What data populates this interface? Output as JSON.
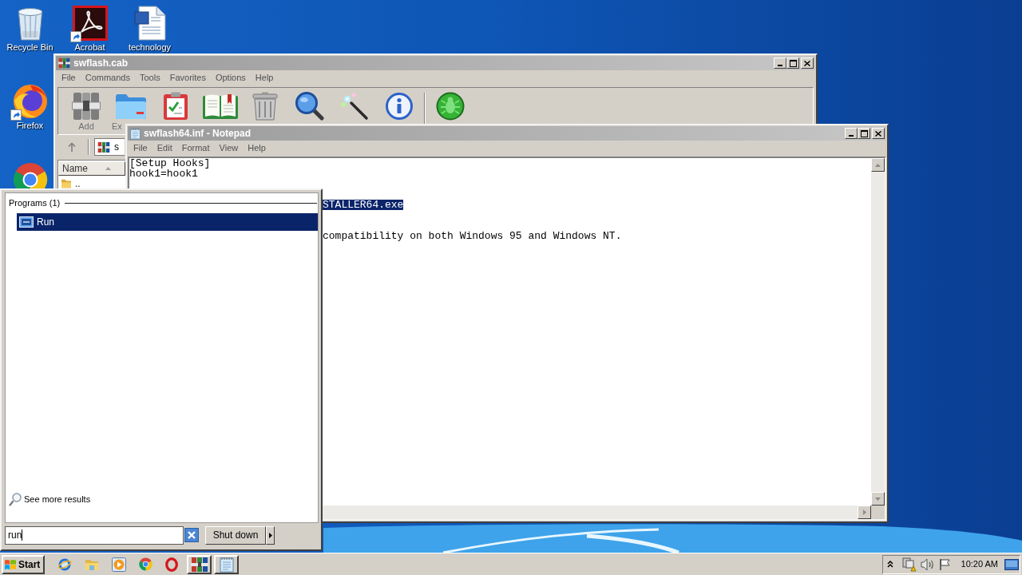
{
  "desktop": {
    "icons": [
      {
        "kind": "recycle_bin",
        "label": "Recycle Bin",
        "shortcut": false
      },
      {
        "kind": "swirl_tile",
        "label": "Acrobat",
        "shortcut": true
      },
      {
        "kind": "document",
        "label": "technology",
        "shortcut": false
      },
      {
        "kind": "fox_globe",
        "label": "Firefox",
        "shortcut": true
      },
      {
        "kind": "tricolor_circle"
      }
    ]
  },
  "archive_window": {
    "title": "swflash.cab",
    "menu": [
      "File",
      "Commands",
      "Tools",
      "Favorites",
      "Options",
      "Help"
    ],
    "toolbar": [
      {
        "kind": "archive",
        "label": "Add"
      },
      {
        "kind": "folder",
        "label": "Ex"
      },
      {
        "kind": "clipboard"
      },
      {
        "kind": "book"
      },
      {
        "kind": "trash"
      },
      {
        "kind": "magnifier"
      },
      {
        "kind": "wand"
      },
      {
        "kind": "info"
      },
      {
        "kind": "separator"
      },
      {
        "kind": "bug"
      }
    ],
    "address": {
      "value": "s"
    },
    "list": {
      "columns": [
        {
          "label": "Name",
          "sorted": true
        }
      ],
      "rows": [
        {
          "name": ".."
        }
      ]
    }
  },
  "notepad": {
    "title": "swflash64.inf - Notepad",
    "menu": [
      "File",
      "Edit",
      "Format",
      "View",
      "Help"
    ],
    "lines": [
      {
        "text": "[Setup Hooks]",
        "kind": "full",
        "selected": false
      },
      {
        "text": "hook1=hook1",
        "kind": "full",
        "selected": false
      },
      {
        "text": "STALLER64.exe",
        "kind": "cut",
        "selected": true
      },
      {
        "text": "compatibility on both Windows 95 and Windows NT.",
        "kind": "cut",
        "selected": false
      }
    ]
  },
  "start_menu": {
    "group": "Programs (1)",
    "results": [
      {
        "label": "Run",
        "selected": true
      }
    ],
    "more_results": "See more results",
    "search": {
      "value": "run"
    },
    "shutdown": "Shut down"
  },
  "taskbar": {
    "start": "Start",
    "quick_launch": [
      {
        "kind": "ring_orbit"
      },
      {
        "kind": "folder"
      },
      {
        "kind": "play"
      },
      {
        "kind": "tricolor_circle"
      },
      {
        "kind": "ring"
      }
    ],
    "tasks": [
      {
        "kind": "archive"
      },
      {
        "kind": "notepad"
      }
    ],
    "clock": "10:20 AM"
  }
}
